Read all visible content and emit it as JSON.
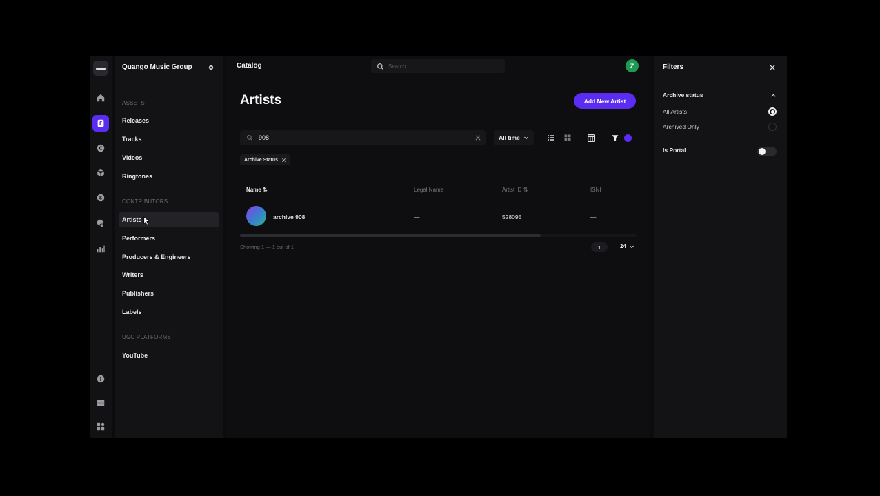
{
  "rail": {
    "items": [
      {
        "icon": "home-icon"
      },
      {
        "icon": "catalog-icon",
        "active": true
      },
      {
        "icon": "copyright-icon"
      },
      {
        "icon": "cube-icon"
      },
      {
        "icon": "dollar-icon"
      },
      {
        "icon": "shield-icon"
      },
      {
        "icon": "analytics-icon"
      },
      {
        "icon": "info-icon"
      },
      {
        "icon": "table-icon"
      },
      {
        "icon": "apps-icon"
      }
    ]
  },
  "sidebar": {
    "org_name": "Quango Music Group",
    "sections": {
      "assets": "ASSETS",
      "contributors": "CONTRIBUTORS",
      "ugc": "UGC PLATFORMS"
    },
    "assets_items": [
      "Releases",
      "Tracks",
      "Videos",
      "Ringtones"
    ],
    "contributors_items": [
      "Artists",
      "Performers",
      "Producers & Engineers",
      "Writers",
      "Publishers",
      "Labels"
    ],
    "ugc_items": [
      "YouTube"
    ]
  },
  "topbar": {
    "title": "Catalog",
    "search_placeholder": "Search",
    "user_initial": "Z"
  },
  "page": {
    "title": "Artists",
    "add_button": "Add New Artist",
    "query": "908",
    "time_filter": "All time",
    "chip": "Archive Status"
  },
  "table": {
    "headers": {
      "name": "Name",
      "legal_name": "Legal Name",
      "artist_id": "Artist ID",
      "isni": "ISNI"
    },
    "rows": [
      {
        "name": "archive 908",
        "legal_name": "—",
        "artist_id": "528095",
        "isni": "—"
      }
    ],
    "showing": "Showing 1 — 1 out of 1",
    "page": "1",
    "per_page": "24"
  },
  "filters": {
    "title": "Filters",
    "archive_status_label": "Archive status",
    "options": [
      "All Artists",
      "Archived Only"
    ],
    "selected": "All Artists",
    "is_portal_label": "Is Portal",
    "is_portal": false
  },
  "colors": {
    "accent": "#5b2cf2",
    "avatar_green": "#1f9a55"
  }
}
